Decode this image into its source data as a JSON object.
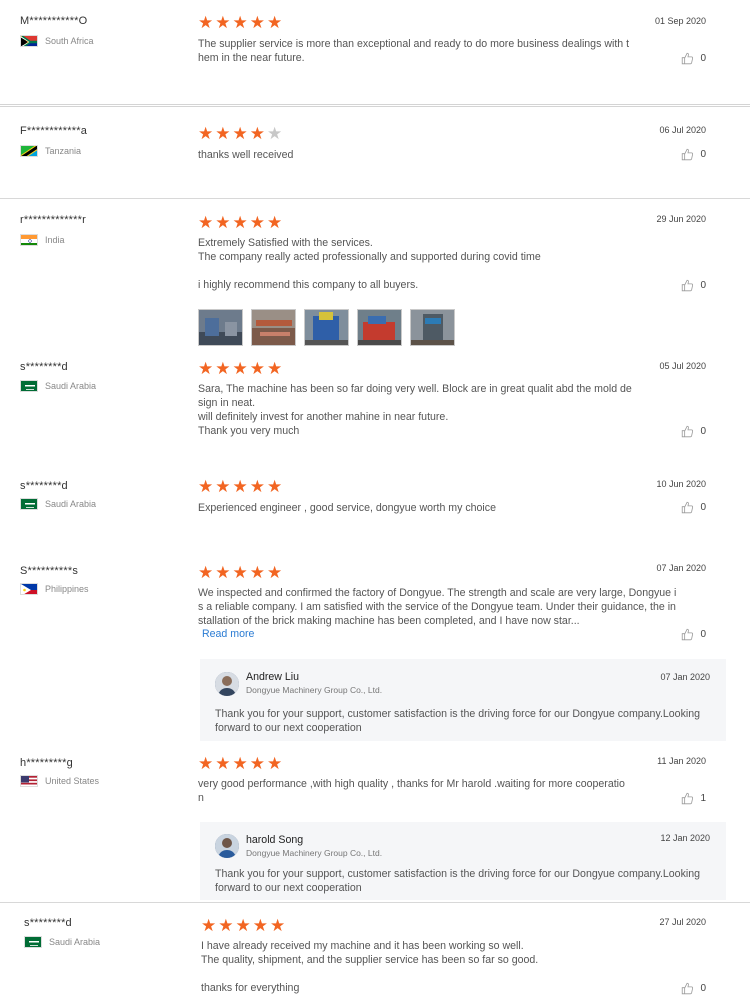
{
  "reviews": [
    {
      "name": "M***********O",
      "country": "South Africa",
      "rating": 5,
      "date": "01 Sep 2020",
      "text": "The supplier service is more than exceptional and ready to do more business dealings with t\nhem in the near future.",
      "likes": "0"
    },
    {
      "name": "F************a",
      "country": "Tanzania",
      "rating": 4,
      "date": "06 Jul 2020",
      "text": "thanks well received",
      "likes": "0"
    },
    {
      "name": "r*************r",
      "country": "India",
      "rating": 5,
      "date": "29 Jun 2020",
      "text": "Extremely Satisfied with the services.\nThe company really acted professionally and supported during covid time\n\ni highly recommend this company to all buyers.",
      "likes": "0",
      "photos": 5
    },
    {
      "name": "s********d",
      "country": "Saudi Arabia",
      "rating": 5,
      "date": "05 Jul 2020",
      "text": "Sara, The machine has been so far doing very well. Block are in great qualit abd the mold de\nsign in neat.\nwill definitely invest for another mahine in near future.\nThank you very much",
      "likes": "0"
    },
    {
      "name": "s********d",
      "country": "Saudi Arabia",
      "rating": 5,
      "date": "10 Jun 2020",
      "text": "Experienced engineer , good service, dongyue worth my choice",
      "likes": "0"
    },
    {
      "name": "S**********s",
      "country": "Philippines",
      "rating": 5,
      "date": "07 Jan 2020",
      "text": "We inspected and confirmed the factory of Dongyue. The strength and scale are very large, Dongyue i\ns a reliable company. I am satisfied with the service of the Dongyue team. Under their guidance, the in\nstallation of the brick making machine has been completed, and I have now star...",
      "read_more": "Read more",
      "likes": "0",
      "reply": {
        "name": "Andrew Liu",
        "company": "Dongyue Machinery Group Co., Ltd.",
        "date": "07 Jan 2020",
        "text": "Thank you for your support, customer satisfaction is the driving force for our Dongyue company.Looking forward to our next cooperation"
      }
    },
    {
      "name": "h*********g",
      "country": "United States",
      "rating": 5,
      "date": "11 Jan 2020",
      "text": "very good performance ,with high quality , thanks for Mr harold .waiting for more cooperatio\nn",
      "likes": "1",
      "reply": {
        "name": "harold Song",
        "company": "Dongyue Machinery Group Co., Ltd.",
        "date": "12 Jan 2020",
        "text": "Thank you for your support, customer satisfaction is the driving force for our Dongyue company.Looking forward to our next cooperation"
      }
    },
    {
      "name": "s********d",
      "country": "Saudi Arabia",
      "rating": 5,
      "date": "27 Jul 2020",
      "text": "I have already received my machine and it has been working so well.\nThe quality, shipment, and the supplier service has been so far so good.\n\nthanks for everything",
      "likes": "0"
    }
  ],
  "colors": {
    "star": "#f26522",
    "star_off": "#c8c8c8",
    "link": "#2b7cd3",
    "reply_bg": "#f5f6f8"
  },
  "icons": {
    "like": "thumbs-up-icon",
    "star": "star-icon"
  }
}
